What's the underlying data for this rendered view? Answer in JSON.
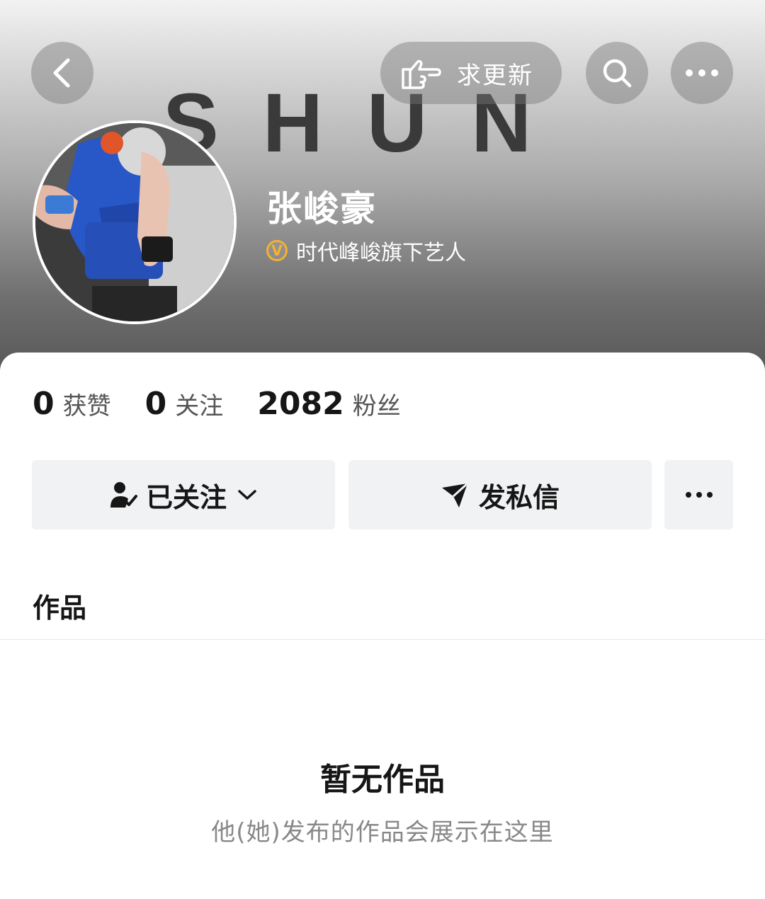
{
  "header": {
    "banner_text": "SHUN",
    "update_label": "求更新",
    "icons": {
      "back": "chevron-left-icon",
      "update": "pointing-hand-icon",
      "search": "search-icon",
      "more": "more-dots-icon"
    }
  },
  "profile": {
    "name": "张峻豪",
    "verified_label": "时代峰峻旗下艺人",
    "verified_badge": "V",
    "badge_color": "#f3b230"
  },
  "stats": [
    {
      "value": "0",
      "label": "获赞"
    },
    {
      "value": "0",
      "label": "关注"
    },
    {
      "value": "2082",
      "label": "粉丝"
    }
  ],
  "actions": {
    "follow_label": "已关注",
    "message_label": "发私信"
  },
  "tab": {
    "label": "作品"
  },
  "empty": {
    "title": "暂无作品",
    "subtitle": "他(她)发布的作品会展示在这里"
  }
}
